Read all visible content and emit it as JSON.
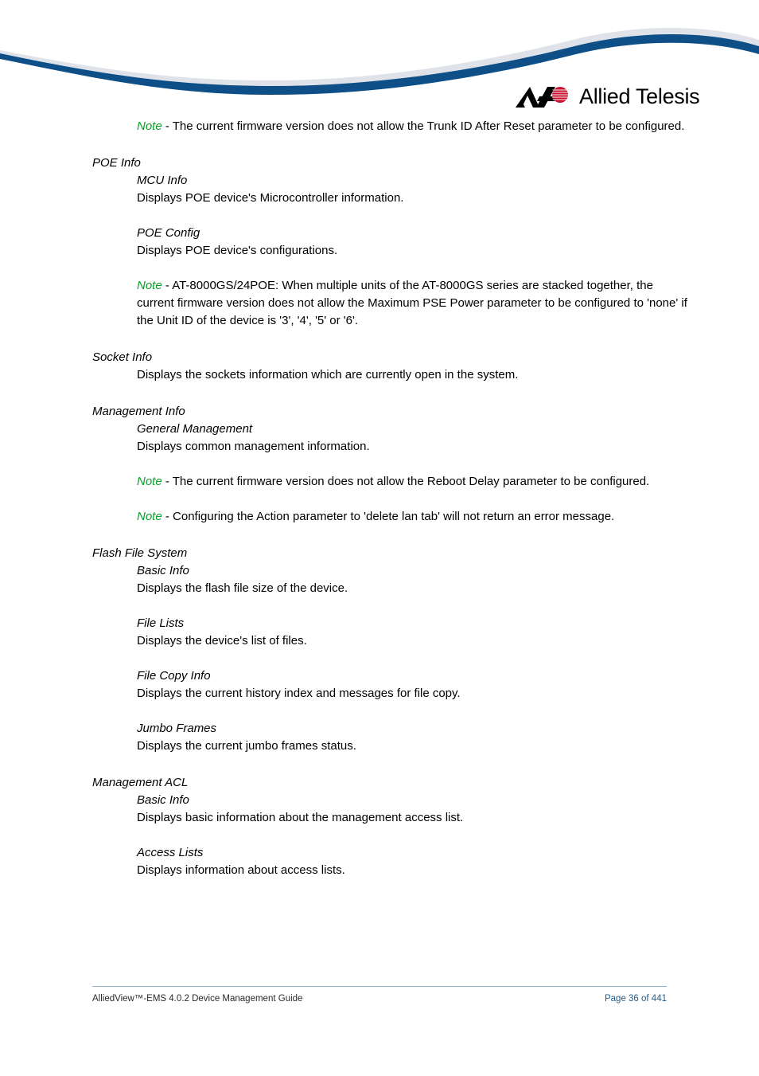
{
  "document": {
    "footer": {
      "doc_title": "AlliedView™-EMS 4.0.2 Device Management Guide",
      "page_number": "Page 36 of 441"
    },
    "brand": {
      "wordmark": "Allied Telesis",
      "logo_mark_name": "allied-telesis-logo-mark",
      "mark_color": "#000000",
      "accent_color": "#c8102e"
    },
    "header": {
      "wave_blue": "#0d4f86",
      "wave_grey": "#dfe3e9"
    },
    "colors": {
      "note_green": "#09a02a",
      "footer_link_blue": "#1d5c8f",
      "footer_rule_blue": "#8cb4ce",
      "body_black": "#000000"
    }
  },
  "content": {
    "note_trunk_id": {
      "label": "Note",
      "text": " - The current firmware version does not allow the Trunk ID After Reset parameter to be configured."
    },
    "poe_info": {
      "heading": "POE Info",
      "mcu_info": {
        "heading": "MCU Info",
        "body": "Displays POE device's Microcontroller information."
      },
      "poe_config": {
        "heading": "POE Config",
        "body": "Displays POE device's configurations."
      },
      "note_8000gs": {
        "label": "Note",
        "text": " - AT-8000GS/24POE: When multiple units of the AT-8000GS series are stacked together, the current firmware version does not allow the Maximum PSE Power parameter to be configured to 'none' if the Unit ID of the device is '3', '4', '5' or '6'."
      }
    },
    "socket_info": {
      "heading": "Socket Info",
      "body": "Displays the sockets information which are currently open in the system."
    },
    "management_info": {
      "heading": "Management Info",
      "general_management": {
        "heading": "General Management",
        "body": "Displays common management information."
      },
      "note_reboot_delay": {
        "label": "Note",
        "text": " - The current firmware version does not allow the Reboot Delay parameter to be configured."
      },
      "note_action_param": {
        "label": "Note",
        "text": " - Configuring the Action parameter to 'delete lan tab' will not return an error message."
      }
    },
    "flash_file_system": {
      "heading": "Flash File System",
      "basic_info": {
        "heading": "Basic Info",
        "body": "Displays the flash file size of the device."
      },
      "file_lists": {
        "heading": "File Lists",
        "body": "Displays the device's list of files."
      },
      "file_copy_info": {
        "heading": "File Copy Info",
        "body": "Displays the current history index and messages for file copy."
      },
      "jumbo_frames": {
        "heading": "Jumbo Frames",
        "body": "Displays the current jumbo frames status."
      }
    },
    "management_acl": {
      "heading": "Management ACL",
      "basic_info": {
        "heading": "Basic Info",
        "body": "Displays basic information about the management access list."
      },
      "access_lists": {
        "heading": "Access Lists",
        "body": "Displays information about access lists."
      }
    }
  }
}
